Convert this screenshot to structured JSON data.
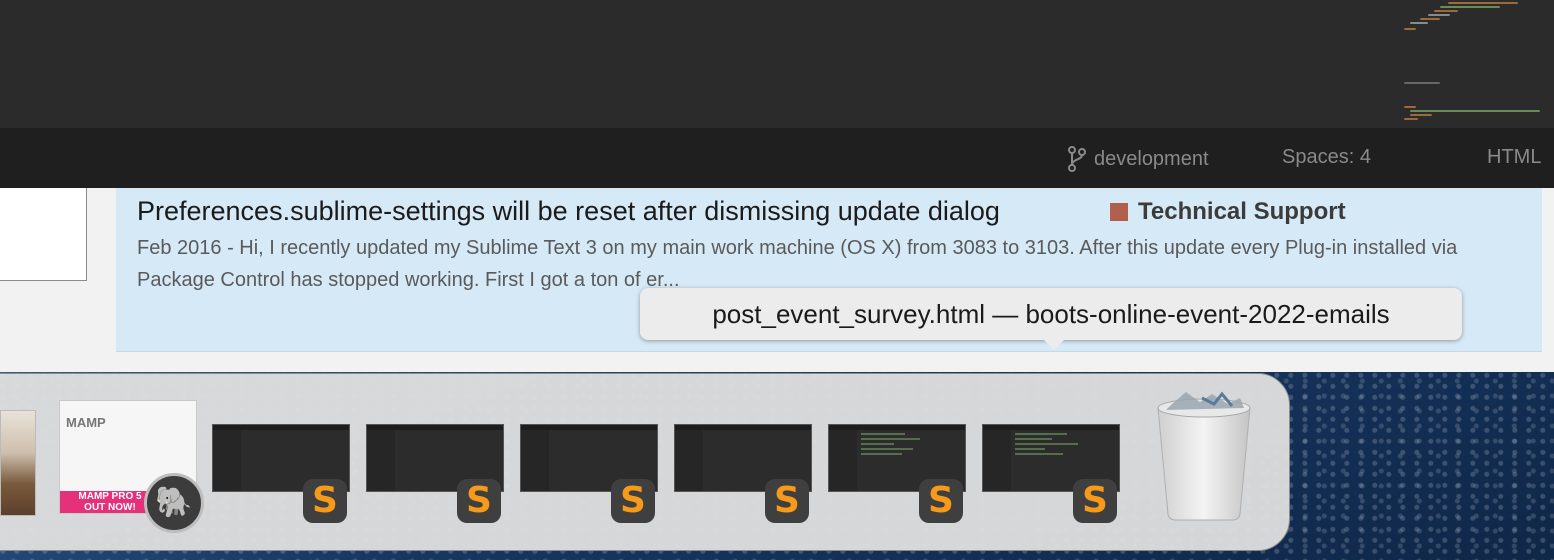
{
  "statusbar": {
    "branch": "development",
    "spaces": "Spaces: 4",
    "syntax": "HTML"
  },
  "search_result": {
    "title": "Preferences.sublime-settings will be reset after dismissing update dialog",
    "category": "Technical Support",
    "category_color": "#b0604c",
    "snippet": "Feb 2016 - Hi, I recently updated my Sublime Text 3 on my main work machine (OS X) from 3083 to 3103. After this update every Plug-in installed via Package Control has stopped working. First I got a ton of er..."
  },
  "tooltip": {
    "text": "post_event_survey.html — boots-online-event-2022-emails"
  },
  "dock": {
    "mamp": {
      "logo": "MAMP",
      "banner_line1": "MAMP PRO 5",
      "banner_line2": "OUT NOW!",
      "icon": "mamp-elephant-icon"
    },
    "sublime_windows": 6,
    "sublime_icon": "sublime-text-icon",
    "trash_icon": "trash-icon"
  },
  "colors": {
    "editor_bg": "#2b2b2b",
    "statusbar_bg": "#1f1f1f",
    "result_bg": "#d6e9f6",
    "sublime_orange": "#f79a19",
    "mamp_pink": "#e5317a"
  }
}
